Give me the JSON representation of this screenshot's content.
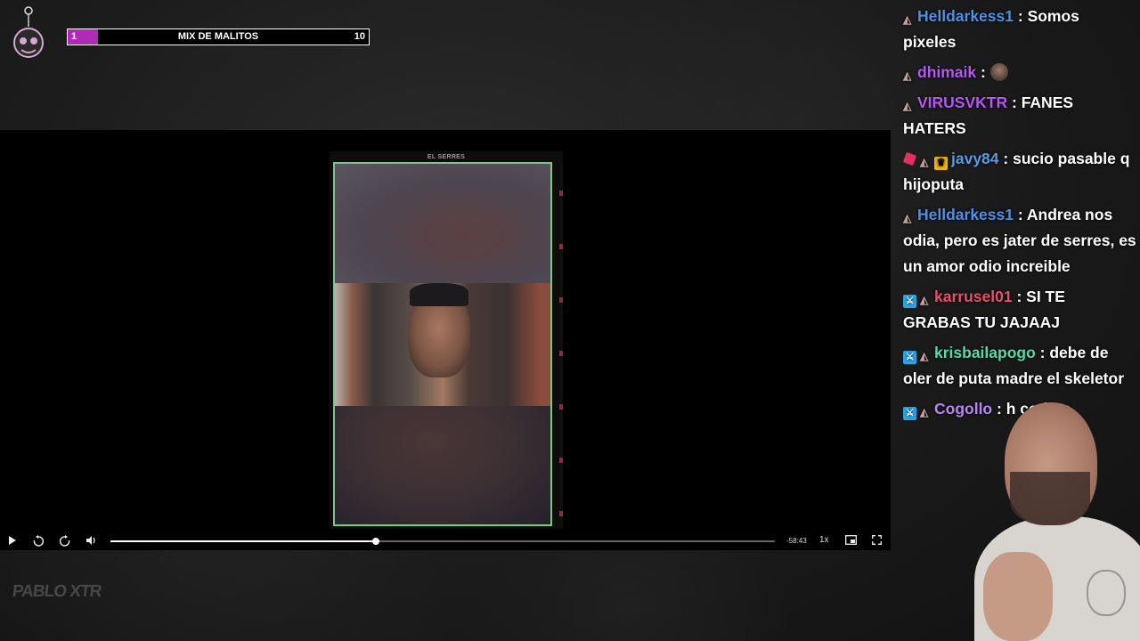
{
  "overlay": {
    "progress": {
      "min_label": "1",
      "max_label": "10",
      "title": "MIX DE MALITOS",
      "value_fraction": 0.1,
      "fill_color": "#b02bb3"
    }
  },
  "player": {
    "video_label": "EL SERRES",
    "controls": {
      "play_icon": "play-icon",
      "rewind_icon": "rewind-5-icon",
      "forward_icon": "forward-5-icon",
      "volume_icon": "volume-icon",
      "progress_fraction": 0.4,
      "time_remaining": "-58:43",
      "rate": "1x",
      "pip_icon": "picture-in-picture-icon",
      "fullscreen_icon": "fullscreen-icon"
    }
  },
  "watermark": "PABLO XTR",
  "chat": [
    {
      "badges": [
        "skin"
      ],
      "user": "Helldarkess1",
      "color": "#4f8fe8",
      "text": "Somos pixeles"
    },
    {
      "badges": [
        "skin"
      ],
      "user": "dhimaik",
      "color": "#b25af0",
      "text": "",
      "emote": true
    },
    {
      "badges": [
        "skin"
      ],
      "user": "VIRUSVKTR",
      "color": "#b25af0",
      "text": "FANES HATERS"
    },
    {
      "badges": [
        "gem",
        "skin",
        "crown"
      ],
      "user": "javy84",
      "color": "#5a9ae6",
      "text": "sucio pasable q hijoputa"
    },
    {
      "badges": [
        "skin"
      ],
      "user": "Helldarkess1",
      "color": "#4f8fe8",
      "text": "Andrea nos odia, pero es jater de serres, es un amor odio increible"
    },
    {
      "badges": [
        "mod",
        "skin"
      ],
      "user": "karrusel01",
      "color": "#e8506a",
      "text": "SI TE GRABAS TU JAJAAJ"
    },
    {
      "badges": [
        "mod",
        "skin"
      ],
      "user": "krisbailapogo",
      "color": "#58d8a8",
      "text": "debe de oler de puta madre el skeletor"
    },
    {
      "badges": [
        "mod",
        "skin"
      ],
      "user": "Cogollo",
      "color": "#b58af0",
      "text": "h codigo"
    }
  ]
}
